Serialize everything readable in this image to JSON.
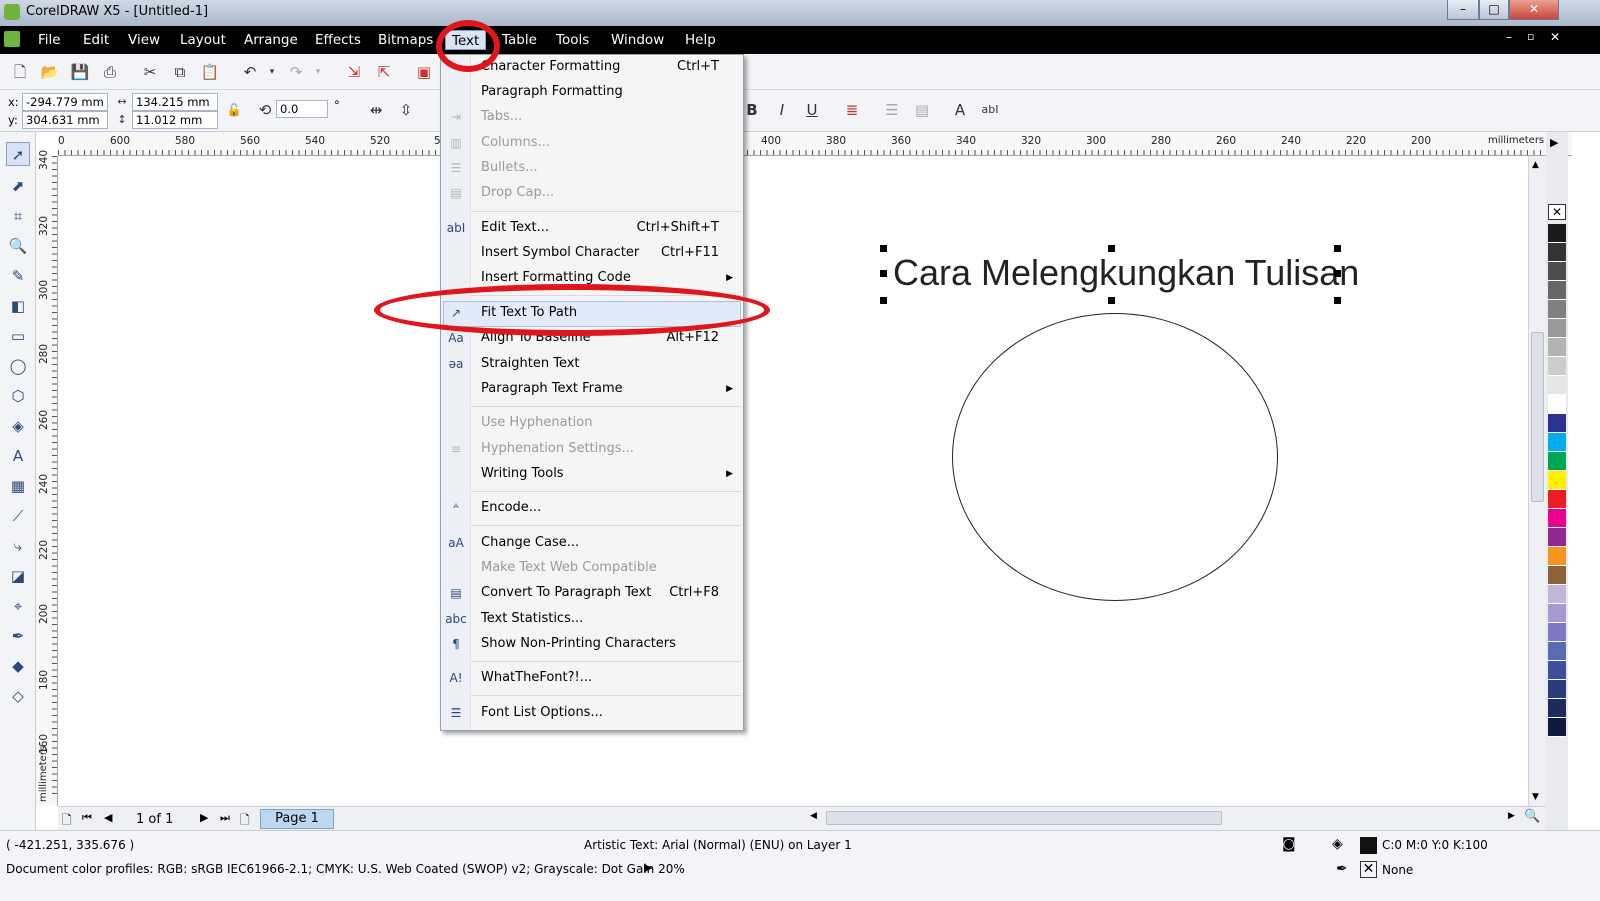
{
  "window": {
    "title": "CorelDRAW X5 - [Untitled-1]",
    "min": "–",
    "max": "□",
    "close": "✕"
  },
  "menubar": {
    "items": [
      "File",
      "Edit",
      "View",
      "Layout",
      "Arrange",
      "Effects",
      "Bitmaps",
      "Text",
      "Table",
      "Tools",
      "Window",
      "Help"
    ],
    "active": "Text"
  },
  "properties": {
    "x_label": "x:",
    "x_value": "-294.779 mm",
    "y_label": "y:",
    "y_value": "304.631 mm",
    "width_value": "134.215 mm",
    "height_value": "11.012 mm",
    "rotation_value": "0.0",
    "degree": "°"
  },
  "ruler": {
    "h_ticks": [
      "0",
      "600",
      "580",
      "560",
      "540",
      "520",
      "5",
      "400",
      "380",
      "360",
      "340",
      "320",
      "300",
      "280",
      "260",
      "240",
      "220",
      "200"
    ],
    "h_unit": "millimeters",
    "v_ticks": [
      "340",
      "320",
      "300",
      "280",
      "260",
      "240",
      "220",
      "200",
      "180",
      "160"
    ],
    "v_unit": "millimeters"
  },
  "text_menu": {
    "items": [
      {
        "label": "Character Formatting",
        "shortcut": "Ctrl+T",
        "enabled": true,
        "icon": ""
      },
      {
        "label": "Paragraph Formatting",
        "shortcut": "",
        "enabled": true,
        "icon": ""
      },
      {
        "label": "Tabs...",
        "shortcut": "",
        "enabled": false,
        "icon": "tabs-icon"
      },
      {
        "label": "Columns...",
        "shortcut": "",
        "enabled": false,
        "icon": "columns-icon"
      },
      {
        "label": "Bullets...",
        "shortcut": "",
        "enabled": false,
        "icon": "bullets-icon"
      },
      {
        "label": "Drop Cap...",
        "shortcut": "",
        "enabled": false,
        "icon": "drop-cap-icon"
      },
      {
        "label": "Edit Text...",
        "shortcut": "Ctrl+Shift+T",
        "enabled": true,
        "icon": "edit-text-icon"
      },
      {
        "label": "Insert Symbol Character",
        "shortcut": "Ctrl+F11",
        "enabled": true,
        "icon": ""
      },
      {
        "label": "Insert Formatting Code",
        "shortcut": "",
        "enabled": true,
        "icon": ""
      },
      {
        "label": "Fit Text To Path",
        "shortcut": "",
        "enabled": true,
        "icon": "fit-text-path-icon"
      },
      {
        "label": "Align To Baseline",
        "shortcut": "Alt+F12",
        "enabled": true,
        "icon": "align-baseline-icon"
      },
      {
        "label": "Straighten Text",
        "shortcut": "",
        "enabled": true,
        "icon": "straighten-text-icon"
      },
      {
        "label": "Paragraph Text Frame",
        "shortcut": "",
        "enabled": true,
        "icon": ""
      },
      {
        "label": "Use Hyphenation",
        "shortcut": "",
        "enabled": false,
        "icon": ""
      },
      {
        "label": "Hyphenation Settings...",
        "shortcut": "",
        "enabled": false,
        "icon": "hyphenation-icon"
      },
      {
        "label": "Writing Tools",
        "shortcut": "",
        "enabled": true,
        "icon": ""
      },
      {
        "label": "Encode...",
        "shortcut": "",
        "enabled": true,
        "icon": "encode-icon"
      },
      {
        "label": "Change Case...",
        "shortcut": "",
        "enabled": true,
        "icon": "change-case-icon"
      },
      {
        "label": "Make Text Web Compatible",
        "shortcut": "",
        "enabled": false,
        "icon": ""
      },
      {
        "label": "Convert To Paragraph Text",
        "shortcut": "Ctrl+F8",
        "enabled": true,
        "icon": "convert-icon"
      },
      {
        "label": "Text Statistics...",
        "shortcut": "",
        "enabled": true,
        "icon": "statistics-icon"
      },
      {
        "label": "Show Non-Printing Characters",
        "shortcut": "",
        "enabled": true,
        "icon": "pilcrow-icon"
      },
      {
        "label": "WhatTheFont?!...",
        "shortcut": "",
        "enabled": true,
        "icon": "whatthefont-icon"
      },
      {
        "label": "Font List Options...",
        "shortcut": "",
        "enabled": true,
        "icon": "font-list-icon"
      }
    ]
  },
  "canvas": {
    "artistic_text": "Cara Melengkungkan Tulisan"
  },
  "pages": {
    "counter": "1 of 1",
    "tab": "Page 1"
  },
  "status": {
    "coords": "( -421.251, 335.676 )",
    "object_info": "Artistic Text: Arial (Normal) (ENU) on Layer 1",
    "fill": "C:0 M:0 Y:0 K:100",
    "outline": "None",
    "profiles": "Document color profiles: RGB: sRGB IEC61966-2.1; CMYK: U.S. Web Coated (SWOP) v2; Grayscale: Dot Gain 20%"
  },
  "colors": {
    "highlight_red": "#e0161d",
    "menubar": "#000000",
    "accent_selection": "#d8e3f3"
  },
  "palette": [
    "#1a1a1a",
    "#333333",
    "#4d4d4d",
    "#666666",
    "#808080",
    "#999999",
    "#b3b3b3",
    "#cccccc",
    "#e6e6e6",
    "#ffffff",
    "#2e3192",
    "#00aeef",
    "#00a651",
    "#fff200",
    "#ed1c24",
    "#ec008c",
    "#92278f",
    "#f7941d",
    "#8c6239",
    "#c2b5d9",
    "#a79ad0",
    "#7f79c4",
    "#5a6bb3",
    "#3d4f99",
    "#2b3a7a",
    "#1d2a5c",
    "#0f1a3d"
  ]
}
